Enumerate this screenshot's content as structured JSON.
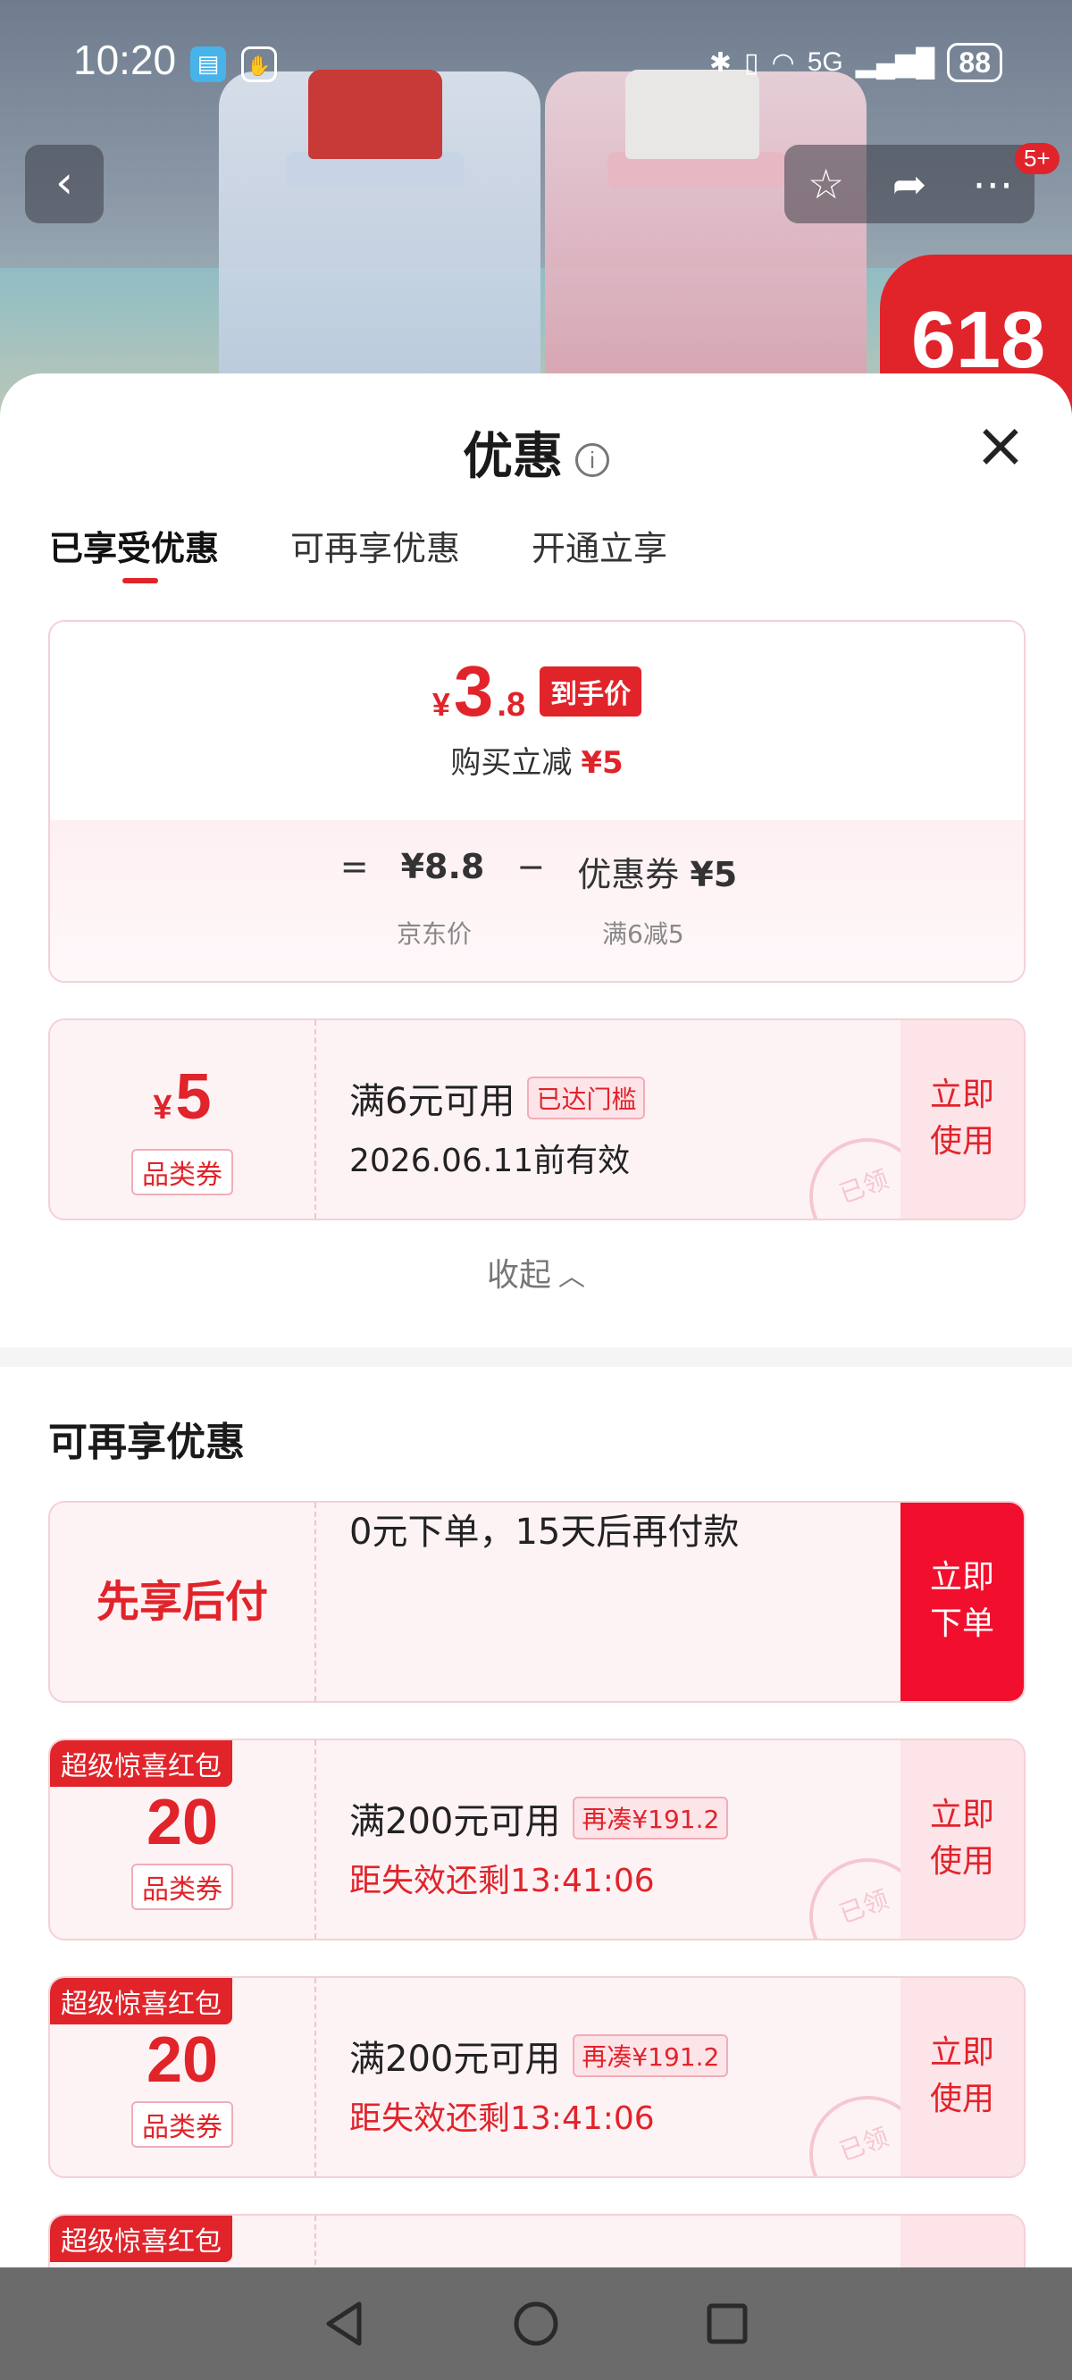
{
  "status_bar": {
    "time": "10:20",
    "network": "5G",
    "battery": "88",
    "icons": [
      "book-icon",
      "hand-icon",
      "bluetooth-icon",
      "vibrate-icon",
      "wifi-icon",
      "signal-icon"
    ]
  },
  "top_nav": {
    "back_icon": "chevron-left-icon",
    "actions": [
      "star-icon",
      "share-icon",
      "more-icon"
    ],
    "badge": "5+",
    "banner": "618"
  },
  "sheet": {
    "title": "优惠",
    "tabs": [
      {
        "label": "已享受优惠",
        "active": true
      },
      {
        "label": "可再享优惠",
        "active": false
      },
      {
        "label": "开通立享",
        "active": false
      }
    ],
    "price": {
      "yen": "¥",
      "int": "3",
      "dec": ".8",
      "tag": "到手价",
      "reduce_label": "购买立减",
      "reduce_value": "¥5",
      "formula_eq": "=",
      "base_price": "¥8.8",
      "minus": "−",
      "coupon_label": "优惠券",
      "coupon_value": "¥5",
      "base_caption": "京东价",
      "coupon_caption": "满6减5"
    },
    "applied_coupon": {
      "yen": "¥",
      "amount": "5",
      "kind": "品类券",
      "condition": "满6元可用",
      "chip": "已达门槛",
      "validity": "2026.06.11前有效",
      "action": "立即使用",
      "stamp": "已领"
    },
    "collapse_label": "收起",
    "section_title": "可再享优惠",
    "bnpl": {
      "label": "先享后付",
      "text": "0元下单，15天后再付款",
      "action": "立即下单"
    },
    "coupons": [
      {
        "ribbon": "超级惊喜红包",
        "amount": "20",
        "kind": "品类券",
        "condition": "满200元可用",
        "chip": "再凑¥191.2",
        "countdown": "距失效还剩13:41:06",
        "action": "立即使用",
        "stamp": "已领"
      },
      {
        "ribbon": "超级惊喜红包",
        "amount": "20",
        "kind": "品类券",
        "condition": "满200元可用",
        "chip": "再凑¥191.2",
        "countdown": "距失效还剩13:41:06",
        "action": "立即使用",
        "stamp": "已领"
      },
      {
        "ribbon": "超级惊喜红包"
      }
    ]
  },
  "system_nav": [
    "back-triangle-icon",
    "home-circle-icon",
    "recents-square-icon"
  ],
  "colors": {
    "accent": "#e1232a",
    "coupon_bg": "#fdf3f5",
    "action_bg": "#fce4e9"
  }
}
